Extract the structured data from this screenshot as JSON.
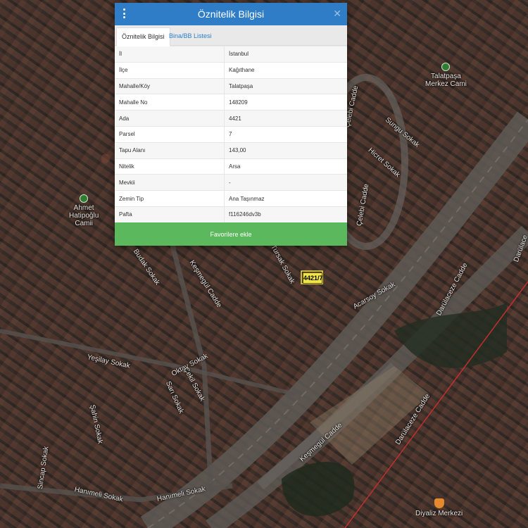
{
  "modal": {
    "title": "Öznitelik Bilgisi",
    "menu_icon": "vertical-dots-icon",
    "close_icon": "close-icon",
    "close_symbol": "✕",
    "tabs": [
      {
        "label": "Öznitelik Bilgisi",
        "active": true
      },
      {
        "label": "Bina/BB Listesi",
        "active": false
      }
    ],
    "rows": [
      {
        "label": "İl",
        "value": "İstanbul"
      },
      {
        "label": "İlçe",
        "value": "Kağıthane"
      },
      {
        "label": "Mahalle/Köy",
        "value": "Talatpaşa"
      },
      {
        "label": "Mahalle No",
        "value": "148209"
      },
      {
        "label": "Ada",
        "value": "4421"
      },
      {
        "label": "Parsel",
        "value": "7"
      },
      {
        "label": "Tapu Alanı",
        "value": "143,00"
      },
      {
        "label": "Nitelik",
        "value": "Arsa"
      },
      {
        "label": "Mevkii",
        "value": "-"
      },
      {
        "label": "Zemin Tip",
        "value": "Ana Taşınmaz"
      },
      {
        "label": "Pafta",
        "value": "f116246dv3b"
      }
    ],
    "favorite_button": "Favorilere ekle",
    "colors": {
      "header": "#2f7dc6",
      "button": "#5cb85c",
      "tab_link": "#2f7dc6"
    }
  },
  "map": {
    "parcel_label": "4421/7",
    "pois": {
      "talatpasa_mosque": [
        "Talatpaşa",
        "Merkez Cami"
      ],
      "ahmet_mosque": [
        "Ahmet",
        "Hatipoğlu",
        "Camii"
      ],
      "hospital": "Diyaliz Merkezi"
    },
    "streets": {
      "celebi_1": "Çelebi Cadde",
      "celebi_2": "Çelebi Cadde",
      "sungu": "Sungu Sokak",
      "hicret": "Hicret Sokak",
      "darulaceze_1": "Darülaceze Cadde",
      "darulaceze_2": "Darülaceze Cadde",
      "darulace_edge": "Darülace",
      "kesmegul_1": "Keşmegül Cadde",
      "kesmegul_2": "Keşmegül Cadde",
      "yesilay": "Yeşilay Sokak",
      "oktay": "Oktay Sokak",
      "cekil": "Çekil Sokak",
      "sari": "Sarı Sokak",
      "sahin": "Şahin Sokak",
      "sincap": "Sincap Sokak",
      "hanimeli_1": "Hanımeli Sokak",
      "hanimeli_2": "Hanımeli Sokak",
      "acarsoy": "Acarsoy Sokak",
      "budak": "Budak Sokak",
      "tursak": "Tursak Sokak"
    },
    "colors": {
      "road": "#6b6762",
      "boundary": "#d32f2f",
      "parcel": "#f0e44a"
    }
  }
}
